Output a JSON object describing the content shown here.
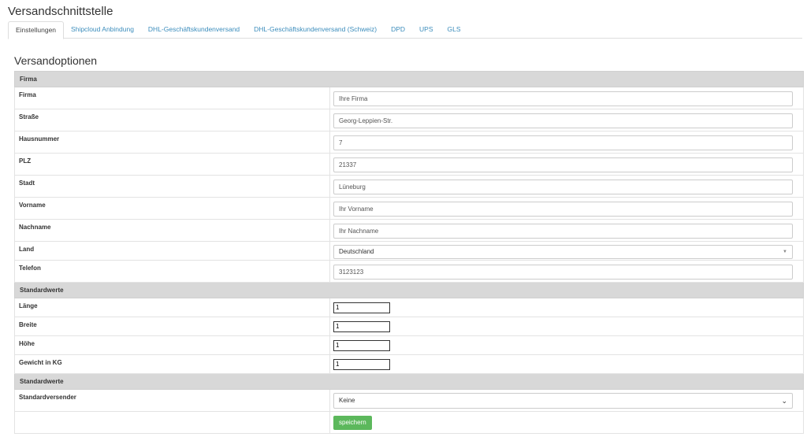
{
  "page": {
    "title": "Versandschnittstelle"
  },
  "tabs": [
    {
      "label": "Einstellungen",
      "active": true
    },
    {
      "label": "Shipcloud Anbindung"
    },
    {
      "label": "DHL-Geschäftskundenversand"
    },
    {
      "label": "DHL-Geschäftskundenversand (Schweiz)"
    },
    {
      "label": "DPD"
    },
    {
      "label": "UPS"
    },
    {
      "label": "GLS"
    }
  ],
  "section": {
    "title": "Versandoptionen"
  },
  "firma": {
    "header": "Firma",
    "fields": {
      "firma": {
        "label": "Firma",
        "value": "Ihre Firma"
      },
      "strasse": {
        "label": "Straße",
        "value": "Georg-Leppien-Str."
      },
      "hausnummer": {
        "label": "Hausnummer",
        "value": "7"
      },
      "plz": {
        "label": "PLZ",
        "value": "21337"
      },
      "stadt": {
        "label": "Stadt",
        "value": "Lüneburg"
      },
      "vorname": {
        "label": "Vorname",
        "value": "Ihr Vorname"
      },
      "nachname": {
        "label": "Nachname",
        "value": "Ihr Nachname"
      },
      "land": {
        "label": "Land",
        "value": "Deutschland"
      },
      "telefon": {
        "label": "Telefon",
        "value": "3123123"
      }
    }
  },
  "standardwerte": {
    "header": "Standardwerte",
    "fields": {
      "laenge": {
        "label": "Länge",
        "value": "1"
      },
      "breite": {
        "label": "Breite",
        "value": "1"
      },
      "hoehe": {
        "label": "Höhe",
        "value": "1"
      },
      "gewicht": {
        "label": "Gewicht in KG",
        "value": "1"
      }
    }
  },
  "standardwerte2": {
    "header": "Standardwerte",
    "versender": {
      "label": "Standardversender",
      "value": "Keine"
    }
  },
  "actions": {
    "save_label": "speichern"
  },
  "colors": {
    "accent": "#3c8dbc",
    "save": "#5cb85c",
    "header_bg": "#d8d8d8"
  }
}
